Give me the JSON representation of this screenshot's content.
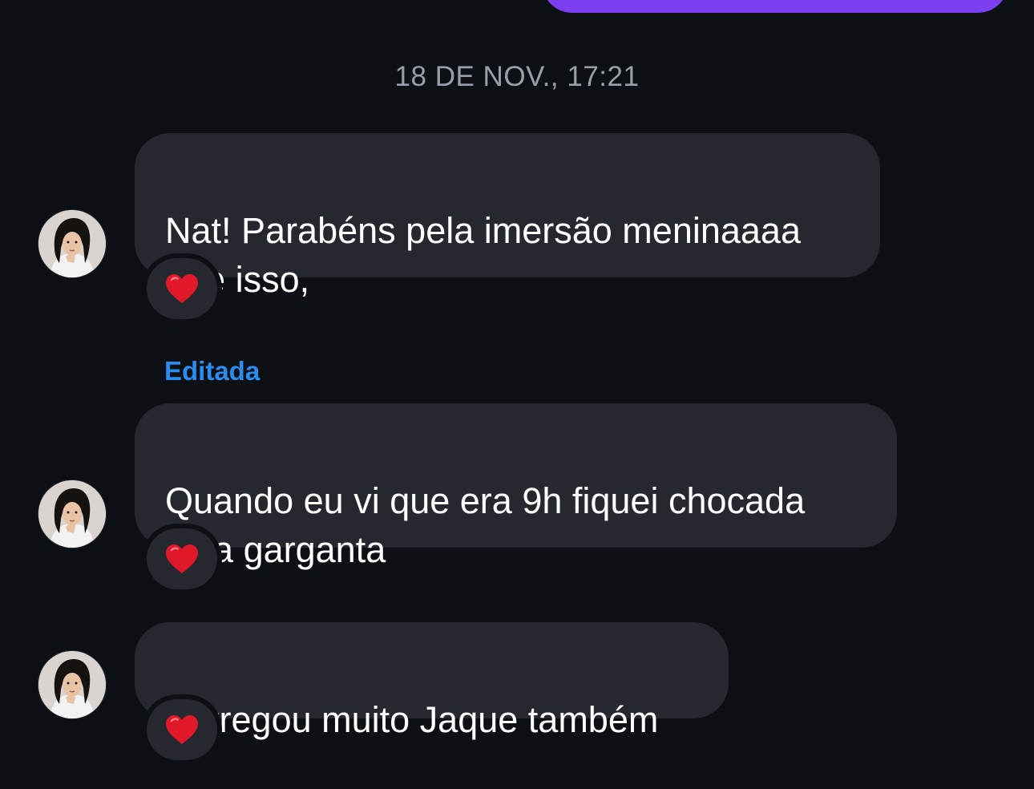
{
  "header": {
    "timestamp": "18 DE NOV., 17:21"
  },
  "messages": [
    {
      "text": "Nat! Parabéns pela imersão meninaaaa\nque isso,",
      "reaction": "red-heart-icon",
      "edited": false
    },
    {
      "edited_label": "Editada",
      "text": "Quando eu vi que era 9h fiquei chocada\nhaja garganta",
      "reaction": "red-heart-icon",
      "edited": true
    },
    {
      "text": "Entregou muito Jaque também",
      "reaction": "red-heart-icon",
      "edited": false
    }
  ],
  "colors": {
    "background": "#0c0f14",
    "received_bubble": "#25282e",
    "sent_bubble": "#7b3ff0",
    "edited_label": "#2b8cf0",
    "timestamp": "#9a9ea8",
    "heart": "#e0182a"
  },
  "icons": {
    "avatar": "contact-avatar-photo",
    "reaction": "red-heart-icon"
  }
}
